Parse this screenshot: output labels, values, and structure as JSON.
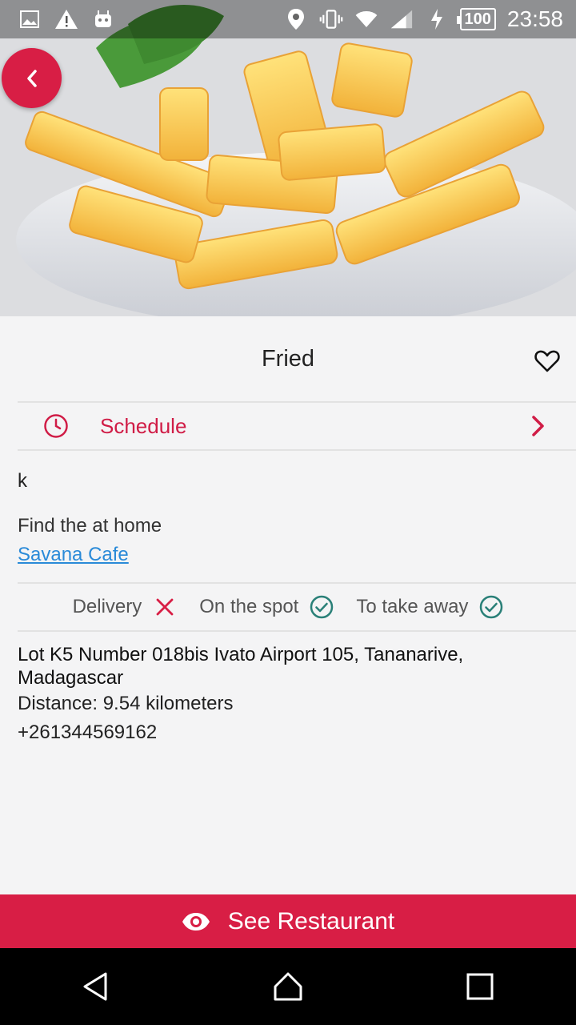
{
  "status_bar": {
    "battery": "100",
    "time": "23:58"
  },
  "hero": {
    "image_subject": "french fries on a plate"
  },
  "product": {
    "title": "Fried",
    "description": "k"
  },
  "schedule": {
    "label": "Schedule"
  },
  "find": {
    "text": "Find the at home",
    "link": "Savana Cafe"
  },
  "services": [
    {
      "label": "Delivery",
      "available": false
    },
    {
      "label": "On the spot",
      "available": true
    },
    {
      "label": "To take away",
      "available": true
    }
  ],
  "restaurant": {
    "address": "Lot K5 Number 018bis Ivato Airport 105, Tananarive, Madagascar",
    "distance": "Distance: 9.54 kilometers",
    "phone": "+261344569162"
  },
  "action": {
    "see_label": "See Restaurant"
  },
  "colors": {
    "accent": "#d81e45",
    "link": "#2a8ad8",
    "available": "#2a8078",
    "unavailable": "#d81e45"
  }
}
